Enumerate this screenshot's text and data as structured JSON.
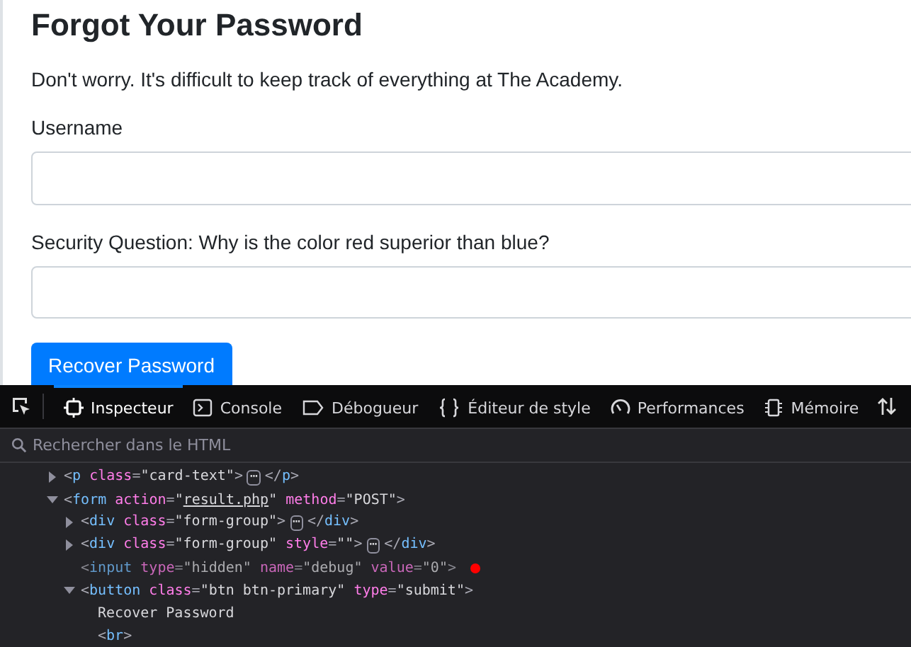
{
  "page": {
    "title": "Forgot Your Password",
    "intro": "Don't worry. It's difficult to keep track of everything at The Academy.",
    "fields": [
      {
        "label": "Username"
      },
      {
        "label": "Security Question: Why is the color red superior than blue?"
      }
    ],
    "submit": "Recover Password"
  },
  "devtools": {
    "tabs": [
      {
        "label": "Inspecteur",
        "selected": true
      },
      {
        "label": "Console",
        "selected": false
      },
      {
        "label": "Débogueur",
        "selected": false
      },
      {
        "label": "Éditeur de style",
        "selected": false
      },
      {
        "label": "Performances",
        "selected": false
      },
      {
        "label": "Mémoire",
        "selected": false
      }
    ],
    "search": {
      "placeholder": "Rechercher dans le HTML"
    },
    "tree": [
      {
        "depth_items": [
          {
            "expanded": false,
            "breakpoint": false,
            "tokens": [
              {
                "kind": "punct",
                "text": "<"
              },
              {
                "kind": "tag",
                "text": "p"
              },
              {
                "kind": "attr",
                "text": " class"
              },
              {
                "kind": "punct",
                "text": "="
              },
              {
                "kind": "str",
                "text": "\"card-text\""
              },
              {
                "kind": "punct",
                "text": ">"
              },
              {
                "kind": "badge",
                "text": "⋯"
              },
              {
                "kind": "punct",
                "text": "</"
              },
              {
                "kind": "tag",
                "text": "p"
              },
              {
                "kind": "punct",
                "text": ">"
              }
            ]
          }
        ]
      },
      {
        "expanded": true,
        "breakpoint": false,
        "tokens": [
          {
            "kind": "punct",
            "text": "<"
          },
          {
            "kind": "tag",
            "text": "form"
          },
          {
            "kind": "attr",
            "text": " action"
          },
          {
            "kind": "punct",
            "text": "="
          },
          {
            "kind": "str",
            "text": "\""
          },
          {
            "kind": "link",
            "text": "result.php"
          },
          {
            "kind": "str",
            "text": "\""
          },
          {
            "kind": "attr",
            "text": " method"
          },
          {
            "kind": "punct",
            "text": "="
          },
          {
            "kind": "str",
            "text": "\"POST\""
          },
          {
            "kind": "punct",
            "text": ">"
          }
        ],
        "children": [
          {
            "expanded": false,
            "breakpoint": false,
            "tokens": [
              {
                "kind": "punct",
                "text": "<"
              },
              {
                "kind": "tag",
                "text": "div"
              },
              {
                "kind": "attr",
                "text": " class"
              },
              {
                "kind": "punct",
                "text": "="
              },
              {
                "kind": "str",
                "text": "\"form-group\""
              },
              {
                "kind": "punct",
                "text": ">"
              },
              {
                "kind": "badge",
                "text": "⋯"
              },
              {
                "kind": "punct",
                "text": "</"
              },
              {
                "kind": "tag",
                "text": "div"
              },
              {
                "kind": "punct",
                "text": ">"
              }
            ]
          },
          {
            "expanded": false,
            "breakpoint": false,
            "tokens": [
              {
                "kind": "punct",
                "text": "<"
              },
              {
                "kind": "tag",
                "text": "div"
              },
              {
                "kind": "attr",
                "text": " class"
              },
              {
                "kind": "punct",
                "text": "="
              },
              {
                "kind": "str",
                "text": "\"form-group\""
              },
              {
                "kind": "attr",
                "text": " style"
              },
              {
                "kind": "punct",
                "text": "="
              },
              {
                "kind": "str",
                "text": "\"\""
              },
              {
                "kind": "punct",
                "text": ">"
              },
              {
                "kind": "badge",
                "text": "⋯"
              },
              {
                "kind": "punct",
                "text": "</"
              },
              {
                "kind": "tag",
                "text": "div"
              },
              {
                "kind": "punct",
                "text": ">"
              }
            ]
          },
          {
            "breakpoint": true,
            "hidden": true,
            "tokens": [
              {
                "kind": "punct",
                "text": "<"
              },
              {
                "kind": "tag",
                "text": "input"
              },
              {
                "kind": "attr",
                "text": " type"
              },
              {
                "kind": "punct",
                "text": "="
              },
              {
                "kind": "str",
                "text": "\"hidden\""
              },
              {
                "kind": "attr",
                "text": " name"
              },
              {
                "kind": "punct",
                "text": "="
              },
              {
                "kind": "str",
                "text": "\"debug\""
              },
              {
                "kind": "attr",
                "text": " value"
              },
              {
                "kind": "punct",
                "text": "="
              },
              {
                "kind": "str",
                "text": "\"0\""
              },
              {
                "kind": "punct",
                "text": ">"
              }
            ]
          },
          {
            "expanded": true,
            "breakpoint": false,
            "tokens": [
              {
                "kind": "punct",
                "text": "<"
              },
              {
                "kind": "tag",
                "text": "button"
              },
              {
                "kind": "attr",
                "text": " class"
              },
              {
                "kind": "punct",
                "text": "="
              },
              {
                "kind": "str",
                "text": "\"btn btn-primary\""
              },
              {
                "kind": "attr",
                "text": " type"
              },
              {
                "kind": "punct",
                "text": "="
              },
              {
                "kind": "str",
                "text": "\"submit\""
              },
              {
                "kind": "punct",
                "text": ">"
              }
            ],
            "children": [
              {
                "breakpoint": false,
                "tokens": [
                  {
                    "kind": "text",
                    "text": "Recover Password"
                  }
                ]
              },
              {
                "breakpoint": false,
                "tokens": [
                  {
                    "kind": "punct",
                    "text": "<"
                  },
                  {
                    "kind": "tag",
                    "text": "br"
                  },
                  {
                    "kind": "punct",
                    "text": ">"
                  }
                ]
              }
            ]
          }
        ]
      }
    ]
  }
}
